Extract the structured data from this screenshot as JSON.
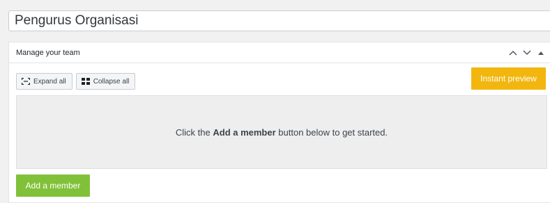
{
  "title_field": {
    "value": "Pengurus Organisasi"
  },
  "postbox": {
    "title": "Manage your team",
    "actions": {
      "move_up_icon": "chevron-up-icon",
      "move_down_icon": "chevron-down-icon",
      "toggle_icon": "caret-up-icon"
    }
  },
  "toolbar": {
    "expand_label": "Expand all",
    "expand_icon": "expand-icon",
    "collapse_label": "Collapse all",
    "collapse_icon": "collapse-icon"
  },
  "preview": {
    "label": "Instant preview"
  },
  "empty_message": {
    "prefix": "Click the ",
    "emphasis": "Add a member",
    "suffix": " button below to get started."
  },
  "add_member": {
    "label": "Add a member"
  },
  "colors": {
    "preview_button": "#f2b60f",
    "add_button": "#81c13a",
    "empty_area": "#eeeeee"
  }
}
